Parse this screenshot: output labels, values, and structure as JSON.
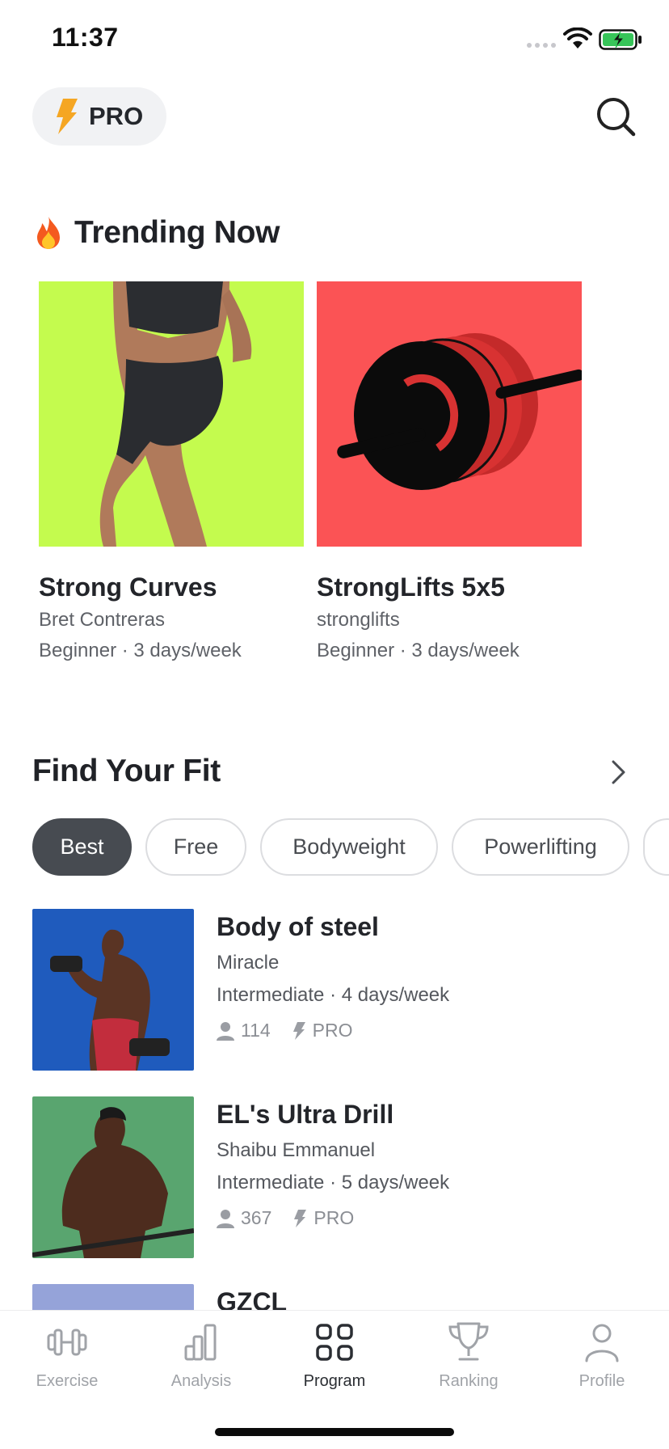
{
  "status_bar": {
    "time": "11:37"
  },
  "header": {
    "pro_label": "PRO",
    "icons": [
      "bolt-icon",
      "search-icon"
    ]
  },
  "trending": {
    "title": "Trending Now",
    "icon": "fire-icon",
    "cards": [
      {
        "name": "Strong Curves",
        "author": "Bret Contreras",
        "meta": "Beginner · 3 days/week",
        "bg": "#c4fb4e"
      },
      {
        "name": "StrongLifts 5x5",
        "author": "stronglifts",
        "meta": "Beginner · 3 days/week",
        "bg": "#fb5355"
      }
    ]
  },
  "find_fit": {
    "title": "Find Your Fit",
    "chips": [
      "Best",
      "Free",
      "Bodyweight",
      "Powerlifting"
    ],
    "active_chip": "Best",
    "programs": [
      {
        "name": "Body of steel",
        "author": "Miracle",
        "meta": "Intermediate · 4 days/week",
        "users": "114",
        "tier": "PRO",
        "bg": "#1f5bbd"
      },
      {
        "name": "EL's Ultra Drill",
        "author": "Shaibu Emmanuel",
        "meta": "Intermediate · 5 days/week",
        "users": "367",
        "tier": "PRO",
        "bg": "#59a56f"
      },
      {
        "name": "GZCL",
        "bg": "#95a3d9"
      }
    ]
  },
  "tab_bar": {
    "tabs": [
      {
        "label": "Exercise",
        "icon": "dumbbell-icon"
      },
      {
        "label": "Analysis",
        "icon": "bar-chart-icon"
      },
      {
        "label": "Program",
        "icon": "grid-icon",
        "active": true
      },
      {
        "label": "Ranking",
        "icon": "trophy-icon"
      },
      {
        "label": "Profile",
        "icon": "person-icon"
      }
    ]
  },
  "colors": {
    "accent": "#f5a623",
    "chip_active": "#474b51",
    "text_primary": "#23252a",
    "text_secondary": "#5f6268"
  }
}
